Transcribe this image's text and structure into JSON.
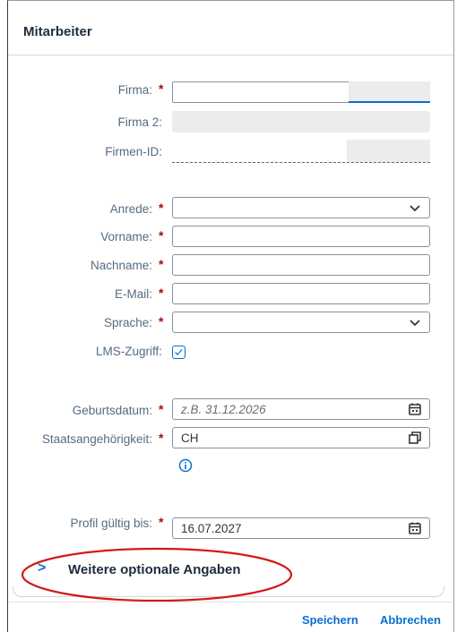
{
  "dialog": {
    "title": "Mitarbeiter"
  },
  "form": {
    "firma_label": "Firma:",
    "firma2_label": "Firma 2:",
    "firmen_id_label": "Firmen-ID:",
    "anrede_label": "Anrede:",
    "vorname_label": "Vorname:",
    "nachname_label": "Nachname:",
    "email_label": "E-Mail:",
    "sprache_label": "Sprache:",
    "lms_label": "LMS-Zugriff:",
    "lms_checked": true,
    "geburtsdatum_label": "Geburtsdatum:",
    "geburtsdatum_placeholder": "z.B. 31.12.2026",
    "staat_label": "Staatsangehörigkeit:",
    "staat_value": "CH",
    "profil_label": "Profil gültig bis:",
    "profil_value": "16.07.2027",
    "required_marker": "*"
  },
  "expander": {
    "label": "Weitere optionale Angaben",
    "chevron": ">"
  },
  "footer": {
    "save_label": "Speichern",
    "cancel_label": "Abbrechen"
  },
  "colors": {
    "accent": "#0a6ed1",
    "required": "#aa0808",
    "annotation": "#d11a1a"
  }
}
